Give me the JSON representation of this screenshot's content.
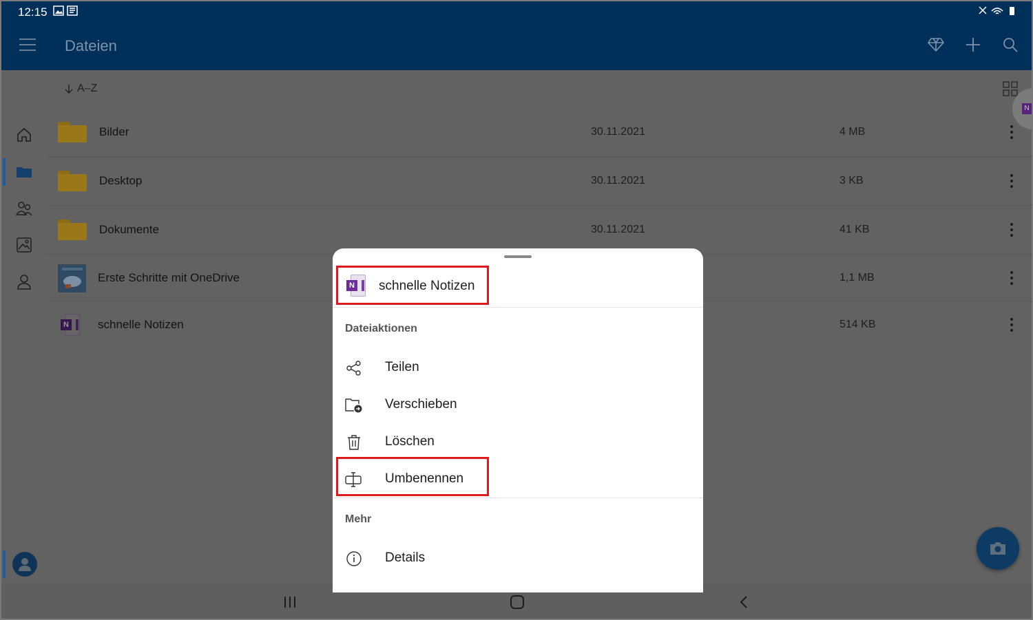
{
  "status_bar": {
    "time": "12:15"
  },
  "app_bar": {
    "title": "Dateien"
  },
  "sort": {
    "label": "A–Z"
  },
  "files": [
    {
      "name": "Bilder",
      "date": "30.11.2021",
      "size": "4 MB",
      "type": "folder"
    },
    {
      "name": "Desktop",
      "date": "30.11.2021",
      "size": "3 KB",
      "type": "folder"
    },
    {
      "name": "Dokumente",
      "date": "30.11.2021",
      "size": "41 KB",
      "type": "folder"
    },
    {
      "name": "Erste Schritte mit OneDrive",
      "date": "",
      "size": "1,1 MB",
      "type": "pdf"
    },
    {
      "name": "schnelle Notizen",
      "date": "",
      "size": "514 KB",
      "type": "onenote"
    }
  ],
  "sheet": {
    "file_name": "schnelle Notizen",
    "section_actions": "Dateiaktionen",
    "actions": [
      {
        "label": "Teilen",
        "icon": "share-icon"
      },
      {
        "label": "Verschieben",
        "icon": "move-folder-icon"
      },
      {
        "label": "Löschen",
        "icon": "trash-icon"
      },
      {
        "label": "Umbenennen",
        "icon": "rename-icon"
      }
    ],
    "section_more": "Mehr",
    "more": [
      {
        "label": "Details",
        "icon": "info-icon"
      }
    ]
  },
  "colors": {
    "app_bar": "#00305a",
    "highlight": "#e0191f",
    "onenote_purple": "#7c3fae",
    "folder_yellow": "#9a7719"
  }
}
